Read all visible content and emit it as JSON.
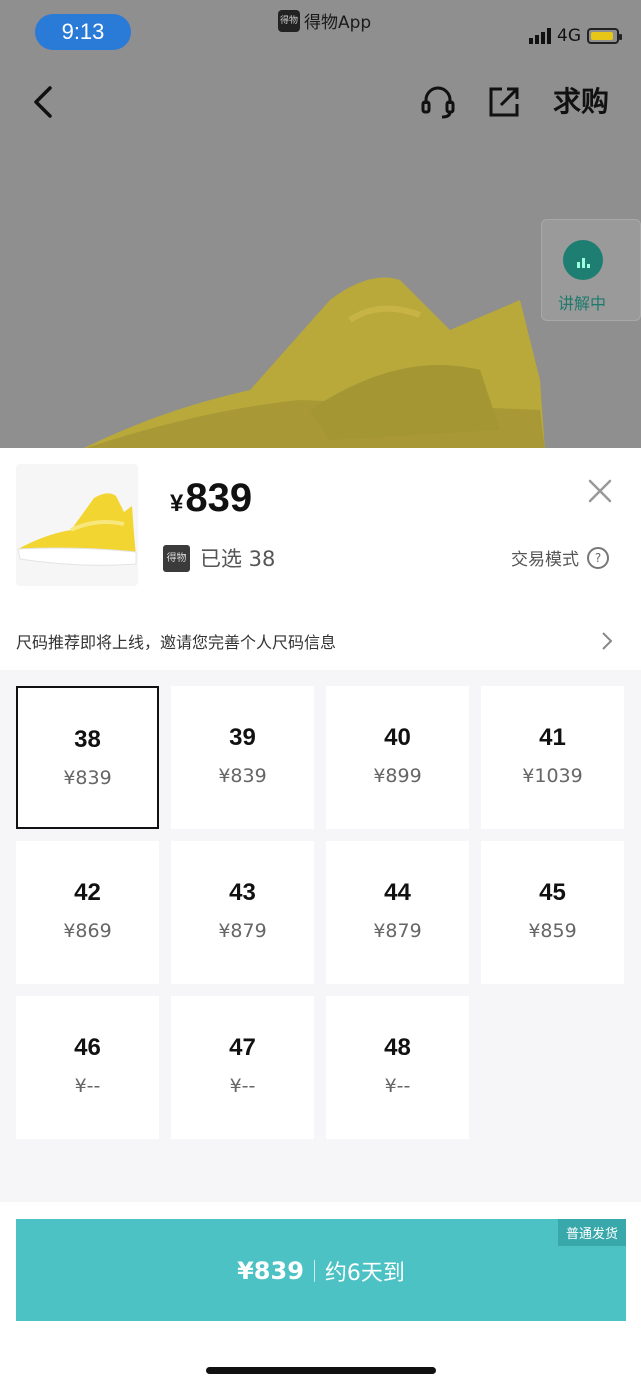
{
  "status_bar": {
    "time": "9:13",
    "app_name": "得物App",
    "app_logo": "得物",
    "network": "4G"
  },
  "nav": {
    "want_label": "求购"
  },
  "live": {
    "label": "讲解中"
  },
  "sheet": {
    "price_symbol": "¥",
    "price_value": "839",
    "dw_tag": "得物",
    "selected_label": "已选 38",
    "trade_mode": "交易模式",
    "tip": "尺码推荐即将上线，邀请您完善个人尺码信息"
  },
  "sizes": [
    {
      "size": "38",
      "price": "¥839",
      "selected": true
    },
    {
      "size": "39",
      "price": "¥839"
    },
    {
      "size": "40",
      "price": "¥899"
    },
    {
      "size": "41",
      "price": "¥1039"
    },
    {
      "size": "42",
      "price": "¥869"
    },
    {
      "size": "43",
      "price": "¥879"
    },
    {
      "size": "44",
      "price": "¥879"
    },
    {
      "size": "45",
      "price": "¥859"
    },
    {
      "size": "46",
      "price": "¥--"
    },
    {
      "size": "47",
      "price": "¥--"
    },
    {
      "size": "48",
      "price": "¥--"
    }
  ],
  "buy": {
    "price": "¥839",
    "eta": "约6天到",
    "shipping_tag": "普通发货"
  },
  "colors": {
    "accent": "#4cc2c4",
    "ship_tag": "#38a8aa",
    "status_time_bg": "#2a7bd8",
    "live_green": "#1f7e72",
    "shoe_yellow": "#f2d530"
  }
}
